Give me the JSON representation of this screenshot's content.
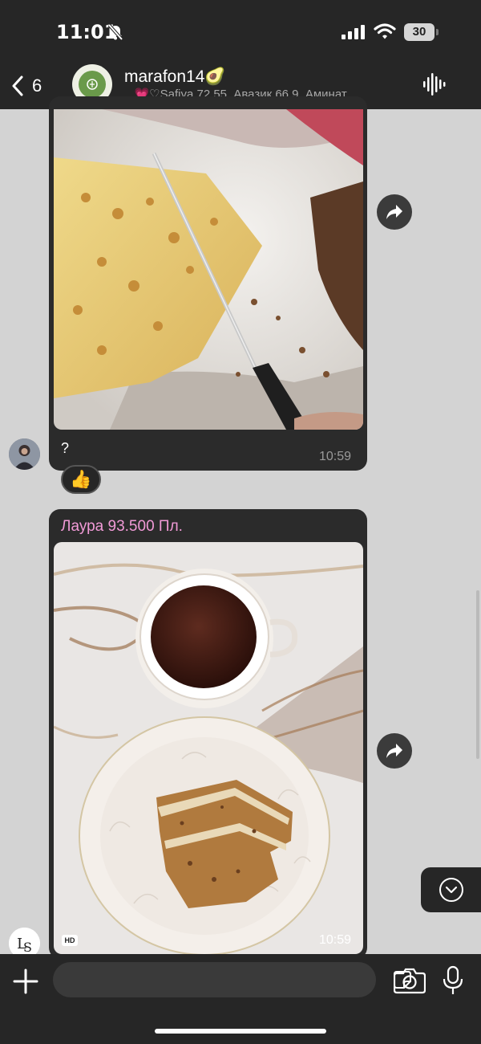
{
  "status_bar": {
    "time": "11:01",
    "battery": "30"
  },
  "header": {
    "back_count": "6",
    "title": "marafon14🥑",
    "subtitle": "., 💗♡Safiya 72.55, Авазик 66.9, Аминат..."
  },
  "messages": [
    {
      "text": "?",
      "time": "10:59",
      "reaction": "👍"
    },
    {
      "sender": "Лаура 93.500 Пл.",
      "time": "10:59",
      "badge": "HD"
    }
  ],
  "colors": {
    "background": "#d3d3d3",
    "bubble": "#2b2b2b",
    "sender_name": "#f19ad7"
  }
}
